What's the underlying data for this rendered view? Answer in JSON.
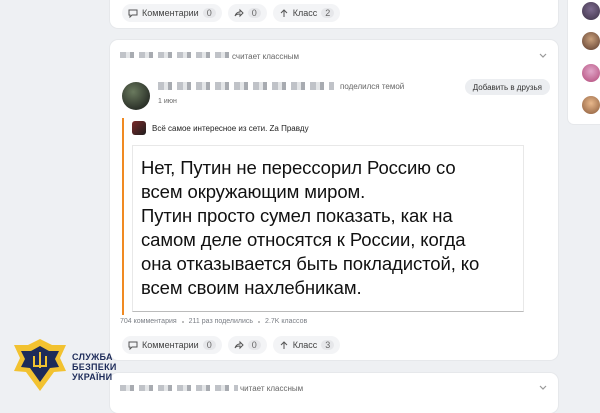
{
  "top_card": {
    "comments_label": "Комментарии",
    "comments_count": "0",
    "shares_count": "0",
    "likes_label": "Класс",
    "likes_count": "2"
  },
  "main_card": {
    "header_action": "считает классным",
    "author_action": "поделился темой",
    "date": "1 июн",
    "add_friend_label": "Добавить в друзья",
    "group_name": "Всё самое интересное из сети. Za Правду",
    "quote_lines": [
      "Нет, Путин не перессорил Россию со",
      "всем окружающим миром.",
      "Путин просто сумел показать, как на",
      "самом деле относятся к России, когда",
      "она отказывается быть покладистой, ко",
      "всем своим нахлебникам."
    ],
    "stats": {
      "comments": "704 комментария",
      "shares": "211 раз поделились",
      "likes": "2.7K классов"
    },
    "actions": {
      "comments_label": "Комментарии",
      "comments_count": "0",
      "shares_count": "0",
      "likes_label": "Класс",
      "likes_count": "3"
    }
  },
  "bottom_card": {
    "header_action": "читает классным"
  },
  "watermark": {
    "line1": "СЛУЖБА",
    "line2": "БЕЗПЕКИ",
    "line3": "УКРАЇНИ"
  },
  "colors": {
    "accent_orange": "#f08a22",
    "sbu_blue": "#1d2b59",
    "sbu_gold": "#f2c230"
  }
}
